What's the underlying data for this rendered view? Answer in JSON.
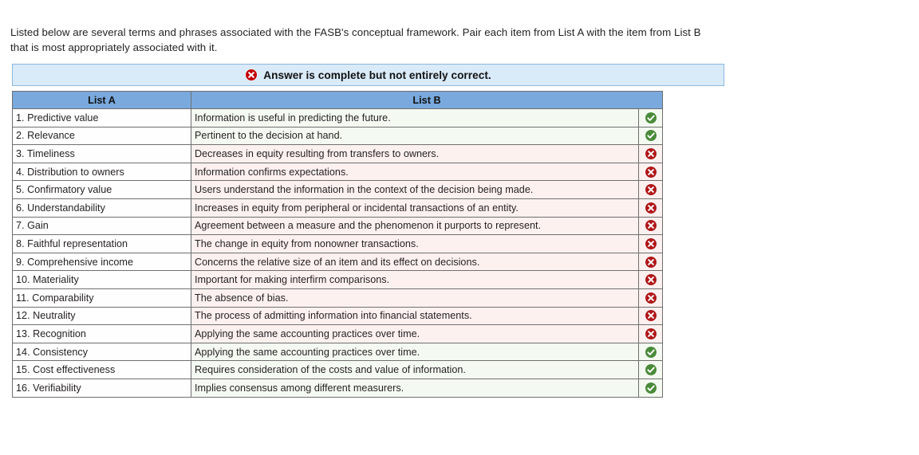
{
  "intro": {
    "text": "Listed below are several terms and phrases associated with the FASB's conceptual framework. Pair each item from List A with the item from List B that is most appropriately associated with it."
  },
  "status_banner": {
    "icon": "error-circle-icon",
    "text": "Answer is complete but not entirely correct.",
    "background_color": "#d9eaf9",
    "border_color": "#8cb8dd",
    "icon_color": "#c00000"
  },
  "table": {
    "headers": {
      "list_a": "List A",
      "list_b": "List B",
      "header_background": "#79a9dd"
    },
    "correct_row_color": "#f4faf2",
    "incorrect_row_color": "#fdf1f0",
    "check_icon_color": "#4a8b3a",
    "x_icon_color": "#b01818",
    "rows": [
      {
        "list_a": "1. Predictive value",
        "list_b": "Information is useful in predicting the future.",
        "result": "correct",
        "icon": "check-circle-icon"
      },
      {
        "list_a": "2. Relevance",
        "list_b": "Pertinent to the decision at hand.",
        "result": "correct",
        "icon": "check-circle-icon"
      },
      {
        "list_a": "3. Timeliness",
        "list_b": "Decreases in equity resulting from transfers to owners.",
        "result": "incorrect",
        "icon": "x-circle-icon"
      },
      {
        "list_a": "4. Distribution to owners",
        "list_b": "Information confirms expectations.",
        "result": "incorrect",
        "icon": "x-circle-icon"
      },
      {
        "list_a": "5. Confirmatory value",
        "list_b": "Users understand the information in the context of the decision being made.",
        "result": "incorrect",
        "icon": "x-circle-icon"
      },
      {
        "list_a": "6. Understandability",
        "list_b": "Increases in equity from peripheral or incidental transactions of an entity.",
        "result": "incorrect",
        "icon": "x-circle-icon"
      },
      {
        "list_a": "7. Gain",
        "list_b": "Agreement between a measure and the phenomenon it purports to represent.",
        "result": "incorrect",
        "icon": "x-circle-icon"
      },
      {
        "list_a": "8. Faithful representation",
        "list_b": "The change in equity from nonowner transactions.",
        "result": "incorrect",
        "icon": "x-circle-icon"
      },
      {
        "list_a": "9. Comprehensive income",
        "list_b": "Concerns the relative size of an item and its effect on decisions.",
        "result": "incorrect",
        "icon": "x-circle-icon"
      },
      {
        "list_a": "10. Materiality",
        "list_b": "Important for making interfirm comparisons.",
        "result": "incorrect",
        "icon": "x-circle-icon"
      },
      {
        "list_a": "11. Comparability",
        "list_b": "The absence of bias.",
        "result": "incorrect",
        "icon": "x-circle-icon"
      },
      {
        "list_a": "12. Neutrality",
        "list_b": "The process of admitting information into financial statements.",
        "result": "incorrect",
        "icon": "x-circle-icon"
      },
      {
        "list_a": "13. Recognition",
        "list_b": "Applying the same accounting practices over time.",
        "result": "incorrect",
        "icon": "x-circle-icon"
      },
      {
        "list_a": "14. Consistency",
        "list_b": "Applying the same accounting practices over time.",
        "result": "correct",
        "icon": "check-circle-icon"
      },
      {
        "list_a": "15. Cost effectiveness",
        "list_b": "Requires consideration of the costs and value of information.",
        "result": "correct",
        "icon": "check-circle-icon"
      },
      {
        "list_a": "16. Verifiability",
        "list_b": "Implies consensus among different measurers.",
        "result": "correct",
        "icon": "check-circle-icon"
      }
    ]
  }
}
